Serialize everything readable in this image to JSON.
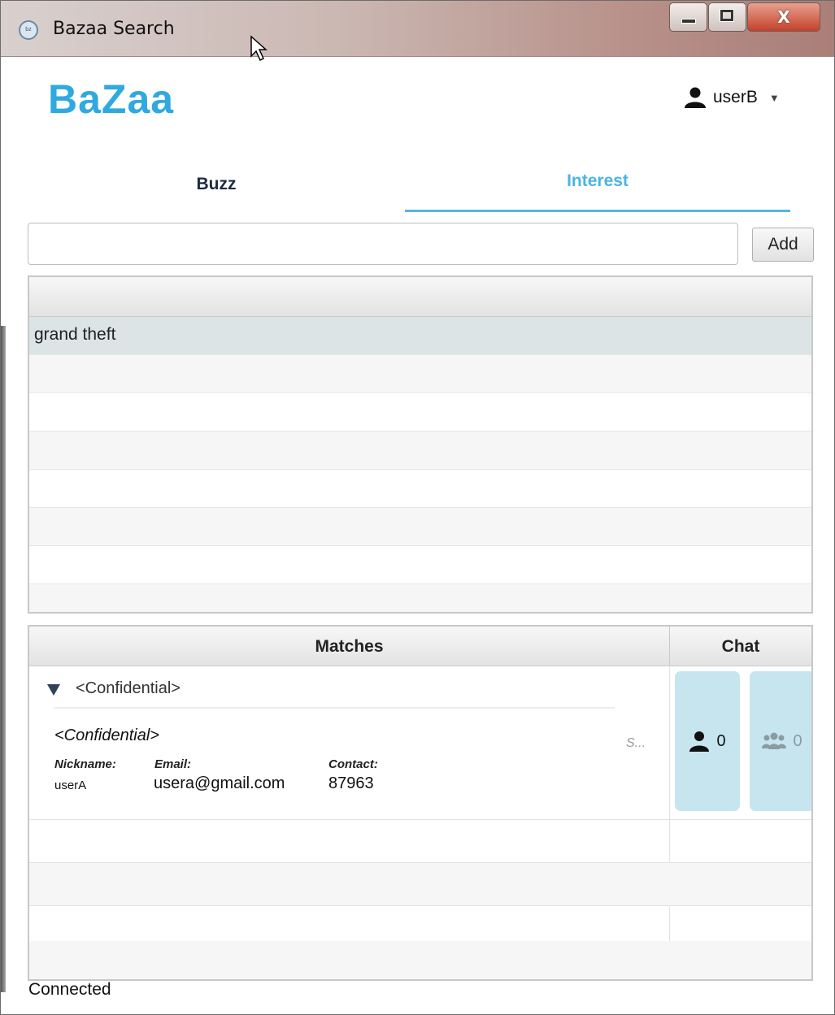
{
  "window": {
    "title": "Bazaa Search",
    "icon": "bazaa-app-icon"
  },
  "header": {
    "logo": "BaZaa",
    "user": {
      "name": "userB",
      "icon": "user-icon"
    }
  },
  "tabs": [
    {
      "label": "Buzz",
      "active": false
    },
    {
      "label": "Interest",
      "active": true
    }
  ],
  "interest_entry": {
    "value": "",
    "add_label": "Add"
  },
  "interests": {
    "rows": [
      "grand theft"
    ]
  },
  "matches": {
    "header_matches": "Matches",
    "header_chat": "Chat",
    "rows": [
      {
        "title": "<Confidential>",
        "description": "<Confidential>",
        "nickname_label": "Nickname:",
        "email_label": "Email:",
        "contact_label": "Contact:",
        "nickname": "userA",
        "email": "usera@gmail.com",
        "contact": "87963",
        "status": "S...",
        "private_chat_count": "0",
        "group_chat_count": "0"
      }
    ]
  },
  "status_bar": {
    "text": "Connected"
  },
  "colors": {
    "accent": "#30a9df",
    "tab_active": "#4ab4e6",
    "chat_button": "#c7e5ef",
    "selected_row": "#dde4e6"
  }
}
